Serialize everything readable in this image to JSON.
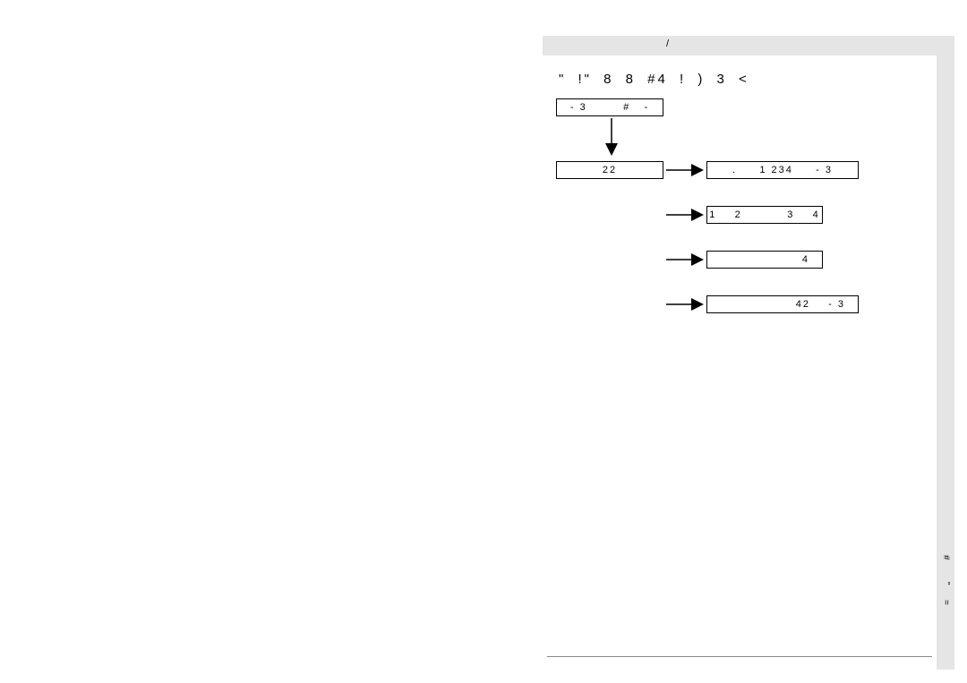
{
  "header": {
    "label": "/"
  },
  "title": "\"  !\"   8     8  #4  !                )    3  <",
  "boxes": {
    "a": "- 3        #   -",
    "b": "22",
    "c": ".     1 234     - 3",
    "d": "1    2          3    4",
    "e": "4",
    "f": "42    - 3"
  },
  "side": {
    "t1": "#",
    "t2": "\"",
    "t3": "="
  }
}
